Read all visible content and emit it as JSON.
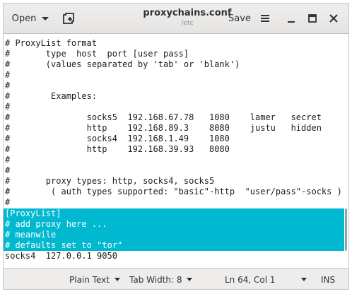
{
  "header": {
    "open_label": "Open",
    "title": "proxychains.conf",
    "subtitle": "/etc",
    "save_label": "Save"
  },
  "editor": {
    "lines": [
      "# ProxyList format",
      "#       type  host  port [user pass]",
      "#       (values separated by 'tab' or 'blank')",
      "#",
      "#",
      "#        Examples:",
      "#",
      "#               socks5  192.168.67.78   1080    lamer   secret",
      "#               http    192.168.89.3    8080    justu   hidden",
      "#               socks4  192.168.1.49    1080",
      "#               http    192.168.39.93   8080",
      "#",
      "#",
      "#       proxy types: http, socks4, socks5",
      "#        ( auth types supported: \"basic\"-http  \"user/pass\"-socks )",
      "#",
      "[ProxyList]",
      "# add proxy here ...",
      "# meanwile",
      "# defaults set to \"tor\"",
      "socks4  127.0.0.1 9050"
    ],
    "selected_line_indices": [
      16,
      17,
      18,
      19
    ],
    "selection_color": "#00b8d0"
  },
  "statusbar": {
    "language": "Plain Text",
    "tab_width": "Tab Width: 8",
    "cursor_position": "Ln 64, Col 1",
    "mode": "INS"
  },
  "icons": {
    "new_document": "new-document-icon",
    "menu": "hamburger-menu-icon",
    "minimize": "minimize-icon",
    "maximize": "maximize-icon",
    "close": "close-icon"
  }
}
